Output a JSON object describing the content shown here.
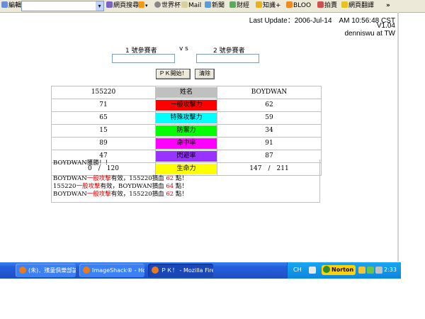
{
  "toolbar": {
    "edit_label": "編輯",
    "items": [
      "網頁搜尋",
      "世界杯",
      "Mail",
      "新聞",
      "財經",
      "知識+",
      "BLOO",
      "拍賣",
      "網頁翻譯"
    ],
    "more": "»",
    "plus": "+"
  },
  "header": {
    "last_update": "Last Update：2006-Jul-14　AM 10:56:48 CST",
    "version": "V1.04",
    "author": "denniswu at TW"
  },
  "players": {
    "p1_label": "1 號參賽者",
    "vs": "v s",
    "p2_label": "2 號參賽者"
  },
  "buttons": {
    "start": "ＰＫ開始！",
    "clear": "清除"
  },
  "stats": {
    "header": {
      "left": "155220",
      "mid": "姓名",
      "right": "BOYDWAN"
    },
    "rows": [
      {
        "left": "71",
        "label": "一般攻擊力",
        "right": "62",
        "color": "#ff0000"
      },
      {
        "left": "65",
        "label": "特殊攻擊力",
        "right": "59",
        "color": "#00ffff"
      },
      {
        "left": "15",
        "label": "防禦力",
        "right": "34",
        "color": "#00ff00"
      },
      {
        "left": "89",
        "label": "命中率",
        "right": "91",
        "color": "#ff00ff"
      },
      {
        "left": "47",
        "label": "閃避率",
        "right": "87",
        "color": "#9933ff"
      },
      {
        "left": "0　/　120",
        "label": "生命力",
        "right": "147　/　211",
        "color": "#ffff00"
      }
    ],
    "header_mid_color": "#c0c0c0"
  },
  "log": {
    "winner": "BOYDWAN獲勝！！",
    "lines": [
      {
        "a": "BOYDWAN",
        "atk": "一般攻擊",
        "b": "有效，155220損血 ",
        "dmg": "62",
        "c": " 點！"
      },
      {
        "a": "155220",
        "atk": "一般攻擊",
        "b": "有效，BOYDWAN損血 ",
        "dmg": "64",
        "c": " 點！"
      },
      {
        "a": "BOYDWAN",
        "atk": "一般攻擊",
        "b": "有效，155220損血 ",
        "dmg": "62",
        "c": " 點！"
      }
    ]
  },
  "taskbar": {
    "tasks": [
      "(未)．殯童俱樂部論...",
      "ImageShack® - Hostin...",
      "ＰＫ！ - Mozilla Firef..."
    ],
    "lang": "CH",
    "norton": "Norton",
    "clock": "2:33"
  }
}
